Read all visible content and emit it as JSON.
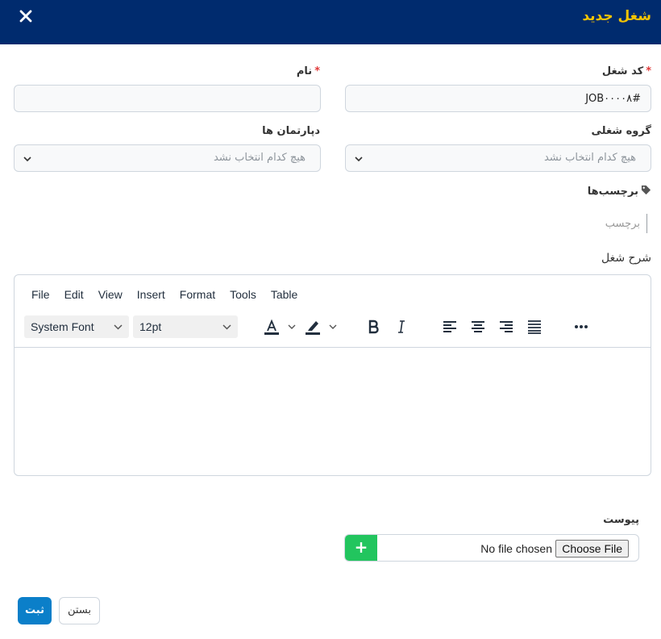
{
  "modal": {
    "title": "شغل جدید",
    "close_icon": "close-icon"
  },
  "form": {
    "job_code": {
      "label": "کد شغل",
      "required_mark": "*",
      "value": "#JOB۰۰۰۰۸"
    },
    "name": {
      "label": "نام",
      "required_mark": "*",
      "value": ""
    },
    "job_group": {
      "label": "گروه شغلی",
      "placeholder": "هیچ کدام انتخاب نشد"
    },
    "departments": {
      "label": "دپارتمان ها",
      "placeholder": "هیچ کدام انتخاب نشد"
    },
    "tags": {
      "label": "برچسب‌ها",
      "icon": "tag-icon",
      "placeholder": "برچسب"
    },
    "description": {
      "label": "شرح شغل"
    }
  },
  "editor": {
    "menu": [
      "File",
      "Edit",
      "View",
      "Insert",
      "Format",
      "Tools",
      "Table"
    ],
    "font_family": "System Font",
    "font_size": "12pt",
    "text_color": "#222f3e",
    "highlight_color": "#222f3e"
  },
  "attachment": {
    "label": "پیوست",
    "add_label": "+",
    "choose_label": "Choose File",
    "status": "No file chosen",
    "add_color": "#22c55e"
  },
  "footer": {
    "submit_label": "ثبت",
    "close_label": "بستن",
    "submit_color": "#0b7fc9"
  },
  "theme": {
    "header_bg": "#002b6e",
    "title_color": "#f5c400",
    "required_color": "#e03a3a"
  }
}
